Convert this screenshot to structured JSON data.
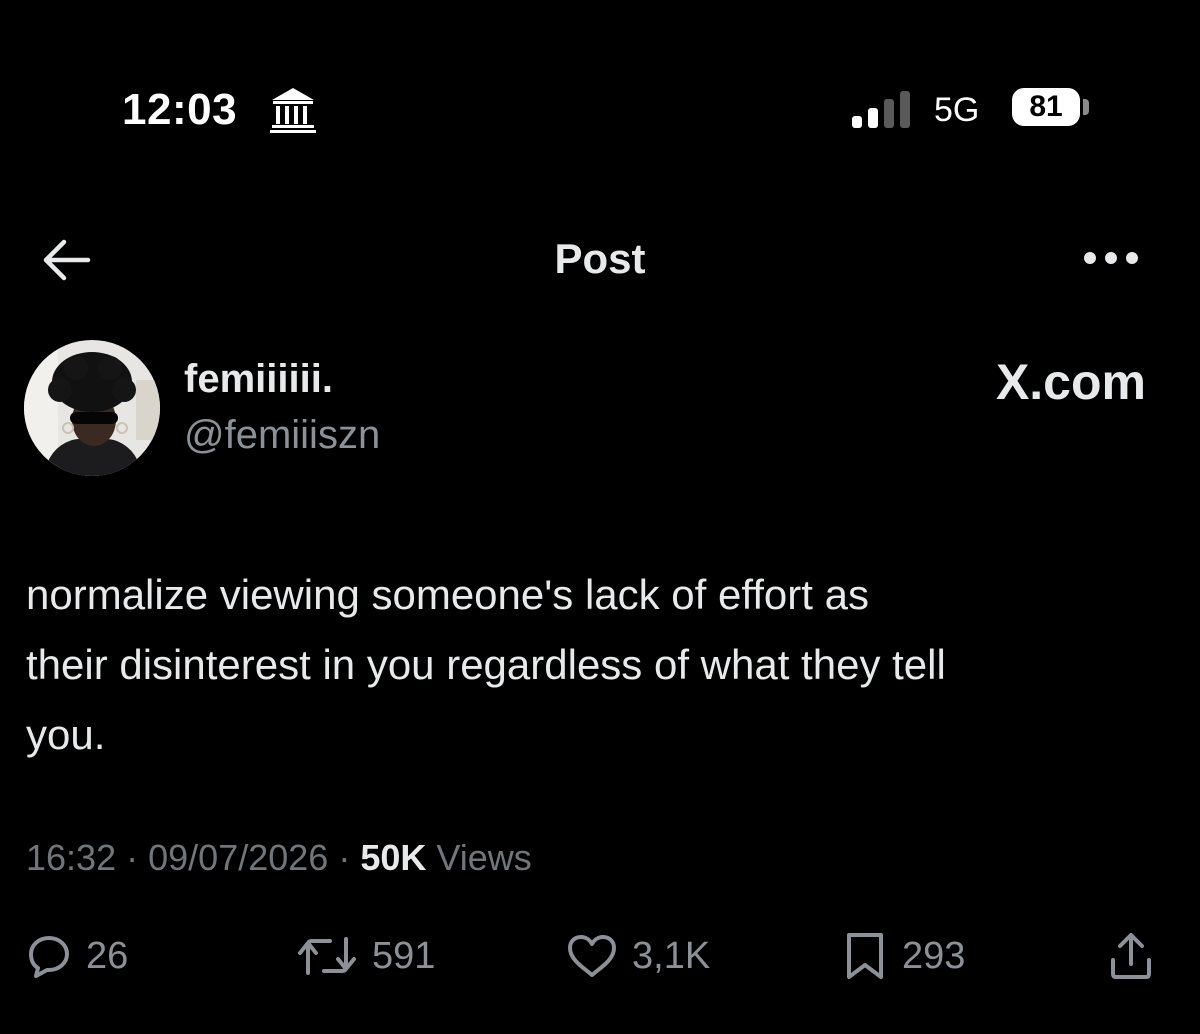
{
  "status_bar": {
    "time": "12:03",
    "network": "5G",
    "battery": "81"
  },
  "header": {
    "title": "Post"
  },
  "post": {
    "author": {
      "display_name": "femiiiiii.",
      "handle": "@femiiiszn"
    },
    "site_label": "X.com",
    "text": "normalize viewing someone's lack of effort as\ntheir disinterest in you regardless of what they tell\nyou.",
    "meta": {
      "time": "16:32",
      "separator": "·",
      "date": "09/07/2026",
      "views_count": "50K",
      "views_label": "Views"
    },
    "actions": {
      "replies": "26",
      "reposts": "591",
      "likes": "3,1K",
      "bookmarks": "293"
    }
  },
  "colors": {
    "background": "#000000",
    "primary_text": "#e7e9ea",
    "secondary_text": "#71767b"
  }
}
